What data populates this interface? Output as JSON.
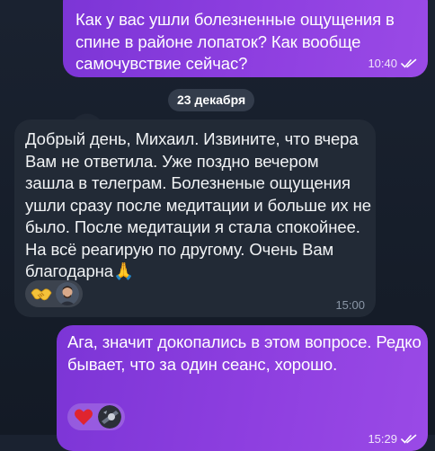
{
  "messages": [
    {
      "direction": "outgoing",
      "text": "Как у вас ушли болезненные ощущения в спине в районе лопаток? Как вообще самочувствие сейчас?",
      "time": "10:40",
      "status": "read"
    },
    {
      "direction": "incoming",
      "text": "Добрый день, Михаил. Извините, что вчера Вам не ответила. Уже поздно вечером зашла в телеграм. Болезненые ощущения ушли сразу после медитации и больше их не было. После медитации я стала спокойнее. На всё реагирую по другому. Очень Вам благодарна🙏",
      "time": "15:00",
      "reactions": [
        "handshake-emoji",
        "reactor-avatar"
      ]
    },
    {
      "direction": "outgoing",
      "text": "Ага, значит докопались в этом вопросе. Редко бывает, что за один сеанс, хорошо.",
      "time": "15:29",
      "status": "read",
      "reactions": [
        "heart-emoji",
        "reactor-avatar"
      ]
    }
  ],
  "date_separator": "23 декабря",
  "colors": {
    "background": "#0e1621",
    "outgoing_bubble": "#8b3fe0",
    "incoming_bubble": "#222a36",
    "incoming_time": "#8a96a6"
  }
}
